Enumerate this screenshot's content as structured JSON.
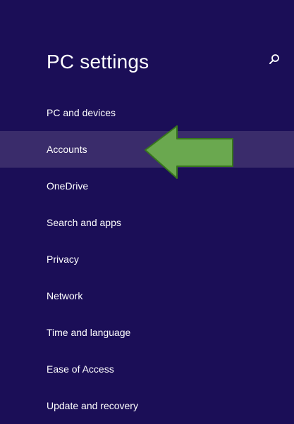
{
  "header": {
    "title": "PC settings",
    "search_icon": "search-icon"
  },
  "nav": {
    "selected_index": 1,
    "items": [
      {
        "label": "PC and devices"
      },
      {
        "label": "Accounts"
      },
      {
        "label": "OneDrive"
      },
      {
        "label": "Search and apps"
      },
      {
        "label": "Privacy"
      },
      {
        "label": "Network"
      },
      {
        "label": "Time and language"
      },
      {
        "label": "Ease of Access"
      },
      {
        "label": "Update and recovery"
      }
    ]
  },
  "annotation": {
    "type": "arrow-left-icon",
    "color": "#6aa84f",
    "points_to": "Accounts"
  },
  "colors": {
    "background": "#1b0e57",
    "selected_row": "#3a2c6b",
    "text": "#ffffff"
  }
}
